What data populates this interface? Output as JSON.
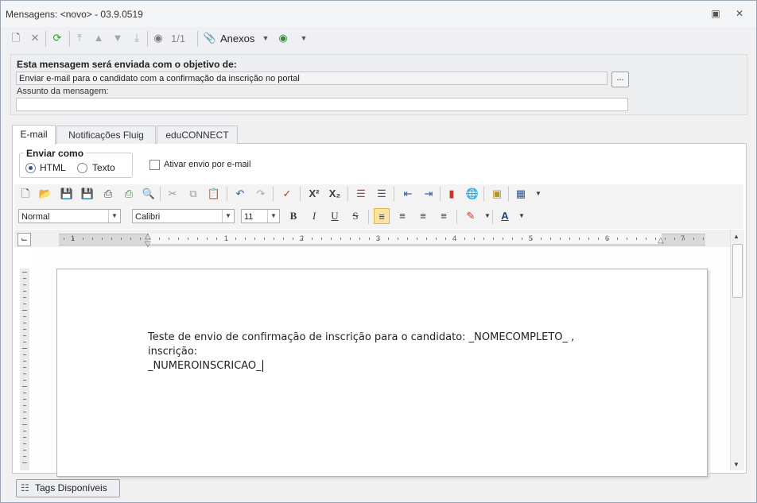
{
  "window": {
    "title": "Mensagens: <novo> - 03.9.0519",
    "restore_icon": "restore-icon",
    "close_icon": "close-icon"
  },
  "toolbar": {
    "record_counter": "1/1",
    "attachments_label": "Anexos"
  },
  "purpose": {
    "label": "Esta mensagem será enviada com o objetivo de:",
    "value": "Enviar e-mail para o candidato com a confirmação da inscrição no portal",
    "browse_label": "...",
    "subject_label": "Assunto da mensagem:",
    "subject_value": ""
  },
  "tabs": [
    "E-mail",
    "Notificações Fluig",
    "eduCONNECT"
  ],
  "send_as": {
    "title": "Enviar como",
    "html_label": "HTML",
    "text_label": "Texto",
    "selected": "HTML"
  },
  "email_send_checkbox": {
    "label": "Ativar envio por e-mail",
    "checked": false
  },
  "format": {
    "style": "Normal",
    "font": "Calibri",
    "size": "11",
    "bold": "B",
    "italic": "I",
    "underline": "U",
    "strike": "S",
    "superscript": "X²",
    "subscript": "X₂",
    "font_color_label": "A"
  },
  "ruler": {
    "numbers": [
      "1",
      "1",
      "2",
      "3",
      "4",
      "5",
      "6",
      "7"
    ]
  },
  "document": {
    "line1": "Teste de envio de confirmação de inscrição para o candidato: _NOMECOMPLETO_ , inscrição:",
    "line2": "_NUMEROINSCRICAO_"
  },
  "footer": {
    "tags_button": "Tags Disponíveis"
  }
}
